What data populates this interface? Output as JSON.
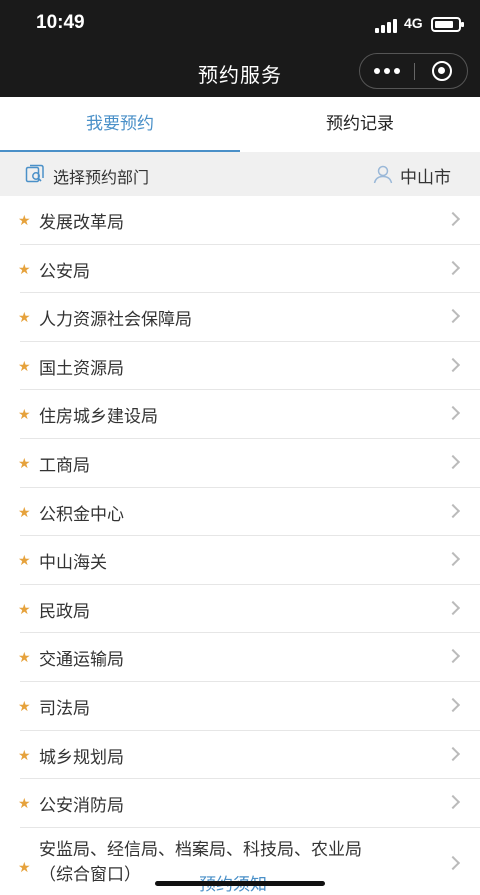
{
  "status_bar": {
    "time": "10:49",
    "network": "4G"
  },
  "nav": {
    "title": "预约服务"
  },
  "tabs": [
    {
      "label": "我要预约",
      "active": true
    },
    {
      "label": "预约记录",
      "active": false
    }
  ],
  "filter": {
    "label": "选择预约部门",
    "location": "中山市"
  },
  "departments": [
    "发展改革局",
    "公安局",
    "人力资源社会保障局",
    "国土资源局",
    "住房城乡建设局",
    "工商局",
    "公积金中心",
    "中山海关",
    "民政局",
    "交通运输局",
    "司法局",
    "城乡规划局",
    "公安消防局"
  ],
  "combined_department": {
    "line1": "安监局、经信局、档案局、科技局、农业局",
    "line2": "（综合窗口）"
  },
  "footer": {
    "link": "预约须知"
  },
  "colors": {
    "accent": "#4a90c8",
    "star": "#e6a23c",
    "header_bg": "#1a1a1a"
  }
}
